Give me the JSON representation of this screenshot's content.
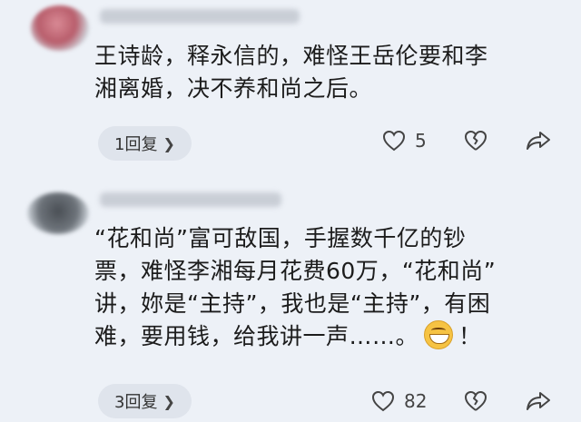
{
  "comments": [
    {
      "text_lines": [
        "王诗龄，释永信的，难怪王岳伦要和李",
        "湘离婚，决不养和尚之后。"
      ],
      "reply_label": "1回复",
      "like_count": "5"
    },
    {
      "text_lines": [
        "“花和尚”富可敌国，手握数千亿的钞",
        "票，难怪李湘每月花费60万，“花和尚”",
        "讲，妳是“主持”，我也是“主持”，有困",
        "难，要用钱，给我讲一声……。",
        "！"
      ],
      "reply_label": "3回复",
      "like_count": "82"
    }
  ],
  "icons": {
    "chevron": "chevron-right-icon",
    "like": "heart-icon",
    "dislike": "broken-heart-icon",
    "share": "share-arrow-icon",
    "emoji": "grin-emoji-icon"
  },
  "colors": {
    "background": "#edf1f7",
    "pill": "#dfe4ec",
    "text": "#1c1c1c",
    "icon": "#444444"
  }
}
